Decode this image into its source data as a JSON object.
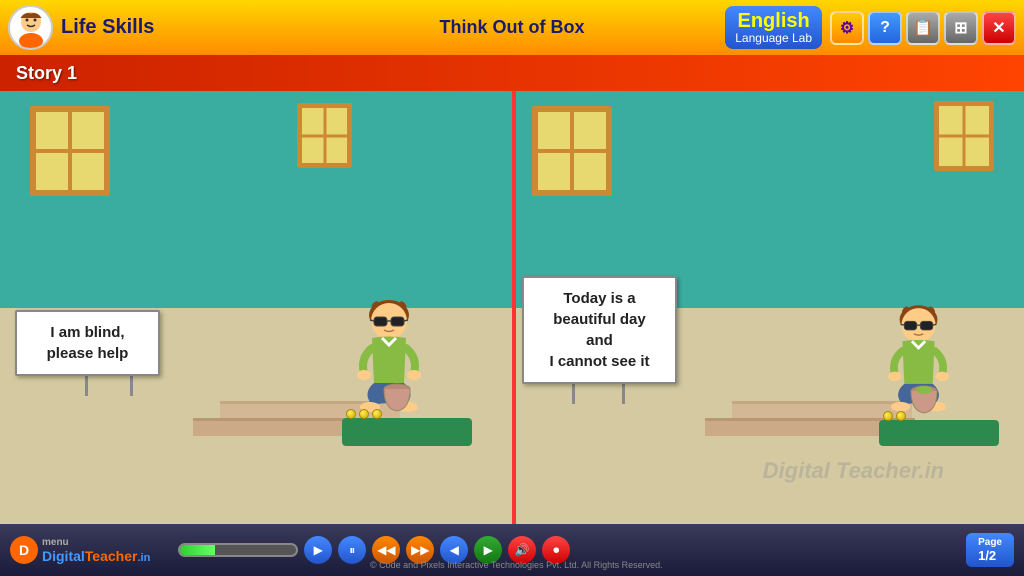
{
  "header": {
    "app_title": "Life Skills",
    "center_title": "Think Out of Box",
    "lang_title": "English",
    "lang_sub": "Language Lab",
    "buttons": {
      "settings_label": "⚙",
      "help_label": "?",
      "book_label": "📖",
      "expand_label": "⊞",
      "close_label": "✕"
    }
  },
  "story_bar": {
    "label": "Story 1"
  },
  "panels": {
    "left": {
      "sign_line1": "I am blind,",
      "sign_line2": "please help"
    },
    "right": {
      "sign_line1": "Today is a",
      "sign_line2": "beautiful day",
      "sign_line3": "and",
      "sign_line4": "I cannot see it"
    }
  },
  "watermark": "Digital Teacher.in",
  "footer": {
    "logo_text": "Digital",
    "logo_accent": "Teacher",
    "logo_suffix": ".in",
    "menu_label": "menu",
    "progress_pct": 30,
    "page_label": "Page",
    "page_current": "1/2"
  }
}
